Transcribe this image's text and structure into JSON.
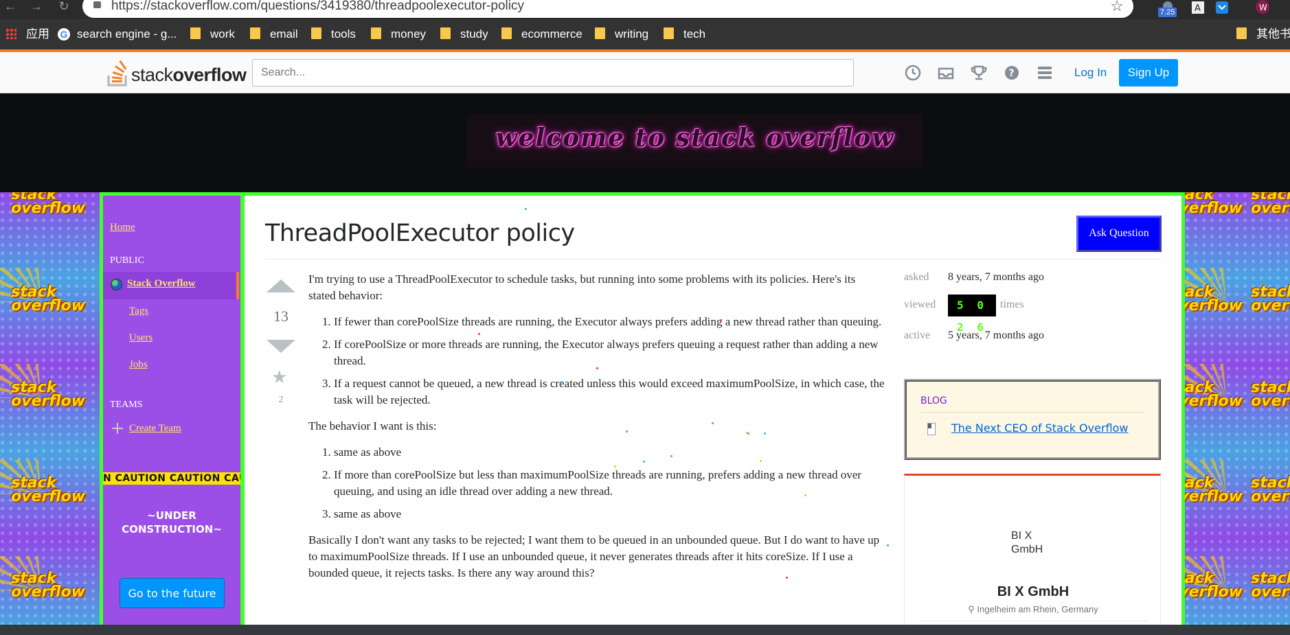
{
  "browser": {
    "url": "https://stackoverflow.com/questions/3419380/threadpoolexecutor-policy",
    "extension_badge": "7.25",
    "profile_initial": "W",
    "bookmarks": [
      {
        "label": "应用"
      },
      {
        "label": "search engine - g..."
      },
      {
        "label": "work"
      },
      {
        "label": "email"
      },
      {
        "label": "tools"
      },
      {
        "label": "money"
      },
      {
        "label": "study"
      },
      {
        "label": "ecommerce"
      },
      {
        "label": "writing"
      },
      {
        "label": "tech"
      },
      {
        "label": "其他书签"
      }
    ]
  },
  "topbar": {
    "logo_light": "stack",
    "logo_bold": "overflow",
    "search_placeholder": "Search...",
    "login_label": "Log In",
    "signup_label": "Sign Up"
  },
  "banner": {
    "text": "welcome to stack overflow"
  },
  "tiles": {
    "text_line1": "stack",
    "text_line2": "overflow"
  },
  "leftnav": {
    "home": "Home",
    "public_heading": "PUBLIC",
    "stack_overflow": "Stack Overflow",
    "tags": "Tags",
    "users": "Users",
    "jobs": "Jobs",
    "teams_heading": "TEAMS",
    "create_team": "Create Team",
    "caution": "N   CAUTION    CAUTION   CAUTION",
    "under_construction_1": "~UNDER",
    "under_construction_2": "CONSTRUCTION~",
    "future_button": "Go to the future"
  },
  "question": {
    "title": "ThreadPoolExecutor policy",
    "ask_button": "Ask Question",
    "votes": "13",
    "favorites": "2",
    "intro": "I'm trying to use a ThreadPoolExecutor to schedule tasks, but running into some problems with its policies. Here's its stated behavior:",
    "stated_behavior": [
      "If fewer than corePoolSize threads are running, the Executor always prefers adding a new thread rather than queuing.",
      "If corePoolSize or more threads are running, the Executor always prefers queuing a request rather than adding a new thread.",
      "If a request cannot be queued, a new thread is created unless this would exceed maximumPoolSize, in which case, the task will be rejected."
    ],
    "want_intro": "The behavior I want is this:",
    "desired_behavior": [
      "same as above",
      "If more than corePoolSize but less than maximumPoolSize threads are running, prefers adding a new thread over queuing, and using an idle thread over adding a new thread.",
      "same as above"
    ],
    "closing": "Basically I don't want any tasks to be rejected; I want them to be queued in an unbounded queue. But I do want to have up to maximumPoolSize threads. If I use an unbounded queue, it never generates threads after it hits coreSize. If I use a bounded queue, it rejects tasks. Is there any way around this?"
  },
  "stats": {
    "asked_label": "asked",
    "asked_value": "8 years, 7 months ago",
    "viewed_label": "viewed",
    "viewed_value": "5 0 2 6",
    "viewed_suffix": "times",
    "active_label": "active",
    "active_value": "5 years, 7 months ago"
  },
  "blog": {
    "heading": "BLOG",
    "link": "The Next CEO of Stack Overflow"
  },
  "job": {
    "image_alt": "BI X GmbH",
    "company": "BI X GmbH",
    "location": "Ingelheim am Rhein, Germany"
  },
  "colors": {
    "so_orange": "#f48024",
    "so_blue": "#0095ff",
    "frame_green": "#42ff2d",
    "sidebar_purple": "#9c4fe6",
    "counter_green": "#62ff1f",
    "ask_button_blue": "#0000ff"
  }
}
